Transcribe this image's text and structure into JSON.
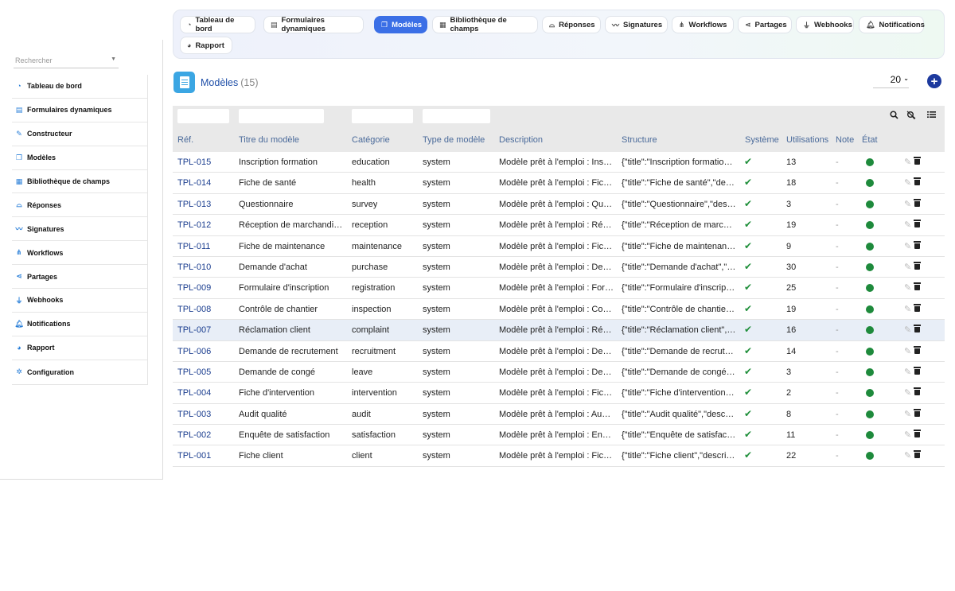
{
  "sidebar": {
    "search_placeholder": "Rechercher",
    "items": [
      {
        "label": "Tableau de bord",
        "icon": "dashboard-icon"
      },
      {
        "label": "Formulaires dynamiques",
        "icon": "clipboard-icon"
      },
      {
        "label": "Constructeur",
        "icon": "magic-wand-icon"
      },
      {
        "label": "Modèles",
        "icon": "copy-icon"
      },
      {
        "label": "Bibliothèque de champs",
        "icon": "table-icon"
      },
      {
        "label": "Réponses",
        "icon": "inbox-icon"
      },
      {
        "label": "Signatures",
        "icon": "signature-icon"
      },
      {
        "label": "Workflows",
        "icon": "workflow-icon"
      },
      {
        "label": "Partages",
        "icon": "share-icon"
      },
      {
        "label": "Webhooks",
        "icon": "plug-icon"
      },
      {
        "label": "Notifications",
        "icon": "bell-icon"
      },
      {
        "label": "Rapport",
        "icon": "pie-chart-icon"
      },
      {
        "label": "Configuration",
        "icon": "gear-icon"
      }
    ]
  },
  "tabs": [
    {
      "label": "Tableau de bord",
      "icon": "dashboard-icon"
    },
    {
      "label": "Formulaires dynamiques",
      "icon": "clipboard-icon"
    },
    {
      "label": "Modèles",
      "icon": "copy-icon",
      "active": true
    },
    {
      "label": "Bibliothèque de champs",
      "icon": "table-icon"
    },
    {
      "label": "Réponses",
      "icon": "inbox-icon"
    },
    {
      "label": "Signatures",
      "icon": "signature-icon"
    },
    {
      "label": "Workflows",
      "icon": "workflow-icon"
    },
    {
      "label": "Partages",
      "icon": "share-icon"
    },
    {
      "label": "Webhooks",
      "icon": "plug-icon"
    },
    {
      "label": "Notifications",
      "icon": "bell-icon"
    },
    {
      "label": "Rapport",
      "icon": "pie-chart-icon"
    }
  ],
  "page": {
    "title": "Modèles",
    "count": "(15)",
    "page_size": "20"
  },
  "table": {
    "columns": [
      "Réf.",
      "Titre du modèle",
      "Catégorie",
      "Type de modèle",
      "Description",
      "Structure",
      "Système",
      "Utilisations",
      "Note",
      "État"
    ],
    "rows": [
      {
        "ref": "TPL-015",
        "title": "Inscription formation",
        "category": "education",
        "type": "system",
        "description": "Modèle prêt à l'emploi : Inscription formation",
        "structure": "{\"title\":\"Inscription formation\",\"description\"",
        "uses": "13",
        "note": "-"
      },
      {
        "ref": "TPL-014",
        "title": "Fiche de santé",
        "category": "health",
        "type": "system",
        "description": "Modèle prêt à l'emploi : Fiche de santé",
        "structure": "{\"title\":\"Fiche de santé\",\"description\"",
        "uses": "18",
        "note": "-"
      },
      {
        "ref": "TPL-013",
        "title": "Questionnaire",
        "category": "survey",
        "type": "system",
        "description": "Modèle prêt à l'emploi : Questionnaire",
        "structure": "{\"title\":\"Questionnaire\",\"description\"",
        "uses": "3",
        "note": "-"
      },
      {
        "ref": "TPL-012",
        "title": "Réception de marchandises",
        "category": "reception",
        "type": "system",
        "description": "Modèle prêt à l'emploi : Réception de marchandises",
        "structure": "{\"title\":\"Réception de marchandises\",\"description\"",
        "uses": "19",
        "note": "-"
      },
      {
        "ref": "TPL-011",
        "title": "Fiche de maintenance",
        "category": "maintenance",
        "type": "system",
        "description": "Modèle prêt à l'emploi : Fiche de maintenance",
        "structure": "{\"title\":\"Fiche de maintenance\",\"description\"",
        "uses": "9",
        "note": "-"
      },
      {
        "ref": "TPL-010",
        "title": "Demande d'achat",
        "category": "purchase",
        "type": "system",
        "description": "Modèle prêt à l'emploi : Demande d'achat",
        "structure": "{\"title\":\"Demande d'achat\",\"description\"",
        "uses": "30",
        "note": "-"
      },
      {
        "ref": "TPL-009",
        "title": "Formulaire d'inscription",
        "category": "registration",
        "type": "system",
        "description": "Modèle prêt à l'emploi : Formulaire d'inscription",
        "structure": "{\"title\":\"Formulaire d'inscription\",\"description\"",
        "uses": "25",
        "note": "-"
      },
      {
        "ref": "TPL-008",
        "title": "Contrôle de chantier",
        "category": "inspection",
        "type": "system",
        "description": "Modèle prêt à l'emploi : Contrôle de chantier",
        "structure": "{\"title\":\"Contrôle de chantier\",\"description\"",
        "uses": "19",
        "note": "-"
      },
      {
        "ref": "TPL-007",
        "title": "Réclamation client",
        "category": "complaint",
        "type": "system",
        "description": "Modèle prêt à l'emploi : Réclamation client",
        "structure": "{\"title\":\"Réclamation client\",\"description\"",
        "uses": "16",
        "note": "-",
        "highlight": true
      },
      {
        "ref": "TPL-006",
        "title": "Demande de recrutement",
        "category": "recruitment",
        "type": "system",
        "description": "Modèle prêt à l'emploi : Demande de recrutement",
        "structure": "{\"title\":\"Demande de recrutement\",\"description\"",
        "uses": "14",
        "note": "-"
      },
      {
        "ref": "TPL-005",
        "title": "Demande de congé",
        "category": "leave",
        "type": "system",
        "description": "Modèle prêt à l'emploi : Demande de congé",
        "structure": "{\"title\":\"Demande de congé\",\"description\"",
        "uses": "3",
        "note": "-"
      },
      {
        "ref": "TPL-004",
        "title": "Fiche d'intervention",
        "category": "intervention",
        "type": "system",
        "description": "Modèle prêt à l'emploi : Fiche d'intervention",
        "structure": "{\"title\":\"Fiche d'intervention\",\"description\"",
        "uses": "2",
        "note": "-"
      },
      {
        "ref": "TPL-003",
        "title": "Audit qualité",
        "category": "audit",
        "type": "system",
        "description": "Modèle prêt à l'emploi : Audit qualité",
        "structure": "{\"title\":\"Audit qualité\",\"description\"",
        "uses": "8",
        "note": "-"
      },
      {
        "ref": "TPL-002",
        "title": "Enquête de satisfaction",
        "category": "satisfaction",
        "type": "system",
        "description": "Modèle prêt à l'emploi : Enquête de satisfaction",
        "structure": "{\"title\":\"Enquête de satisfaction\",\"description\"",
        "uses": "11",
        "note": "-"
      },
      {
        "ref": "TPL-001",
        "title": "Fiche client",
        "category": "client",
        "type": "system",
        "description": "Modèle prêt à l'emploi : Fiche client",
        "structure": "{\"title\":\"Fiche client\",\"description\"",
        "uses": "22",
        "note": "-"
      }
    ]
  },
  "colors": {
    "accent": "#3b6fe6",
    "ref_link": "#1a3d8f",
    "status_active": "#1e8a3c",
    "check": "#1f8f3a"
  }
}
